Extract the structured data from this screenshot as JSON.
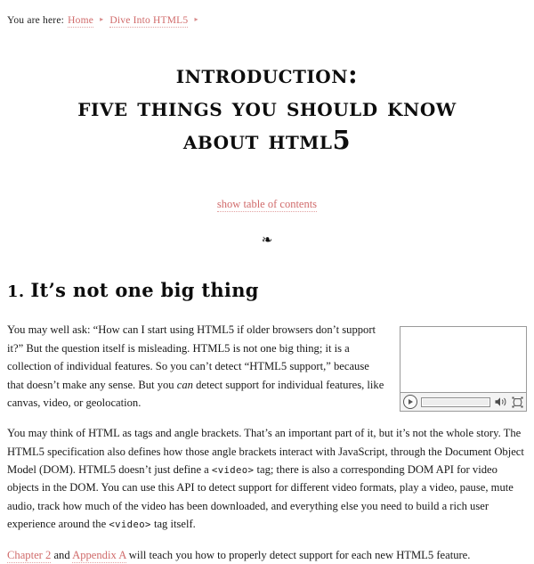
{
  "breadcrumb": {
    "label": "You are here:",
    "items": [
      {
        "text": "Home"
      },
      {
        "text": "Dive Into HTML5"
      }
    ],
    "separator": "▸"
  },
  "title": {
    "line1": "Introduction:",
    "line2": "Five Things You Should Know",
    "line3_prefix": "About HTML",
    "line3_suffix": "5"
  },
  "toc": {
    "link_label": "show table of contents"
  },
  "ornament": {
    "glyph": "❧"
  },
  "section": {
    "number": "1.",
    "heading": "It’s not one big thing"
  },
  "video_player": {
    "play_label": "play",
    "progress_label": "progress",
    "volume_label": "volume",
    "fullscreen_label": "fullscreen"
  },
  "paragraphs": {
    "p1_a": "You may well ask: “How can I start using HTML5 if older browsers don’t support it?” But the question itself is misleading. HTML5 is not one big thing; it is a collection of individual features. So you can’t detect “HTML5 support,” because that doesn’t make any sense. But you ",
    "p1_em": "can",
    "p1_b": " detect support for individual features, like canvas, video, or geolocation.",
    "p2_a": "You may think of HTML as tags and angle brackets. That’s an important part of it, but it’s not the whole story. The HTML5 specification also defines how those angle brackets interact with JavaScript, through the Document Object Model (DOM). HTML5 doesn’t just define a ",
    "p2_code1": "<video>",
    "p2_b": " tag; there is also a corresponding DOM API for video objects in the DOM. You can use this API to detect support for different video formats, play a video, pause, mute audio, track how much of the video has been downloaded, and everything else you need to build a rich user experience around the ",
    "p2_code2": "<video>",
    "p2_c": " tag itself.",
    "p3_link1": "Chapter 2",
    "p3_mid": " and ",
    "p3_link2": "Appendix A",
    "p3_end": " will teach you how to properly detect support for each new HTML5 feature."
  },
  "colors": {
    "link": "#d06a6a",
    "text": "#181818",
    "background": "#ffffff",
    "player_border": "#9a9a9a"
  }
}
